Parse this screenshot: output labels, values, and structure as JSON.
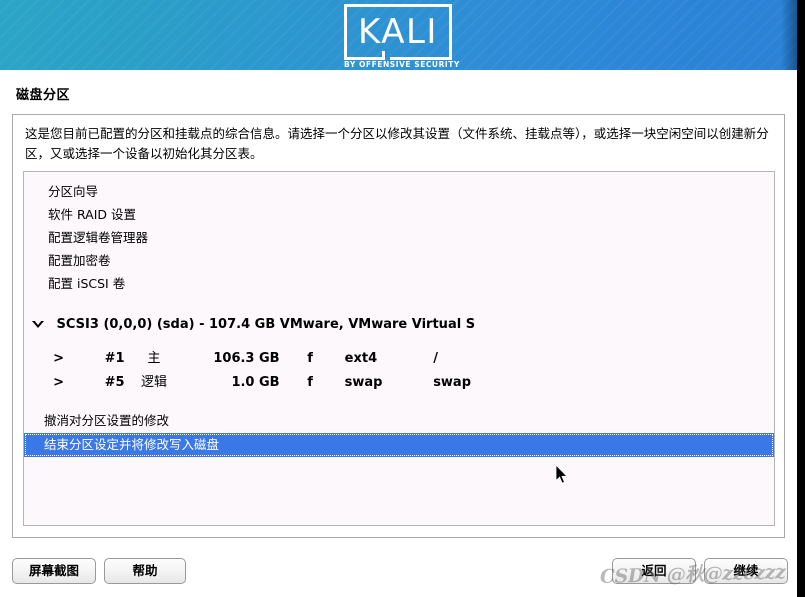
{
  "window": {
    "title": "磁盘分区"
  },
  "banner": {
    "logo_wordmark": "KALI",
    "logo_tagline": "BY OFFENSIVE SECURITY",
    "gradient_start": "#2ba5c6",
    "gradient_end": "#2b81d6"
  },
  "content": {
    "intro_text": "这是您目前已配置的分区和挂载点的综合信息。请选择一个分区以修改其设置（文件系统、挂载点等），或选择一块空闲空间以创建新分区，又或选择一个设备以初始化其分区表。"
  },
  "partition_options": [
    {
      "label": "分区向导"
    },
    {
      "label": "软件 RAID 设置"
    },
    {
      "label": "配置逻辑卷管理器"
    },
    {
      "label": "配置加密卷"
    },
    {
      "label": "配置 iSCSI 卷"
    }
  ],
  "device": {
    "label": "SCSI3 (0,0,0) (sda) - 107.4 GB VMware, VMware Virtual S",
    "expanded": true,
    "disclosure_icon": "triangle-down-icon"
  },
  "partitions": [
    {
      "arrow": ">",
      "number": "#1",
      "type": "主",
      "size": "106.3 GB",
      "flag": "f",
      "filesystem": "ext4",
      "mountpoint": "/"
    },
    {
      "arrow": ">",
      "number": "#5",
      "type": "逻辑",
      "size": "1.0 GB",
      "flag": "f",
      "filesystem": "swap",
      "mountpoint": "swap"
    }
  ],
  "actions": [
    {
      "label": "撤消对分区设置的修改",
      "selected": false
    },
    {
      "label": "结束分区设定并将修改写入磁盘",
      "selected": true
    }
  ],
  "selection": {
    "highlight_color": "#3b78e7",
    "highlight_text_color": "#ffffff"
  },
  "buttons": {
    "screenshot": "屏幕截图",
    "help": "帮助",
    "back": "返回",
    "continue": "继续"
  },
  "overlay": {
    "watermark": "CSDN @秋@zzezzz"
  }
}
